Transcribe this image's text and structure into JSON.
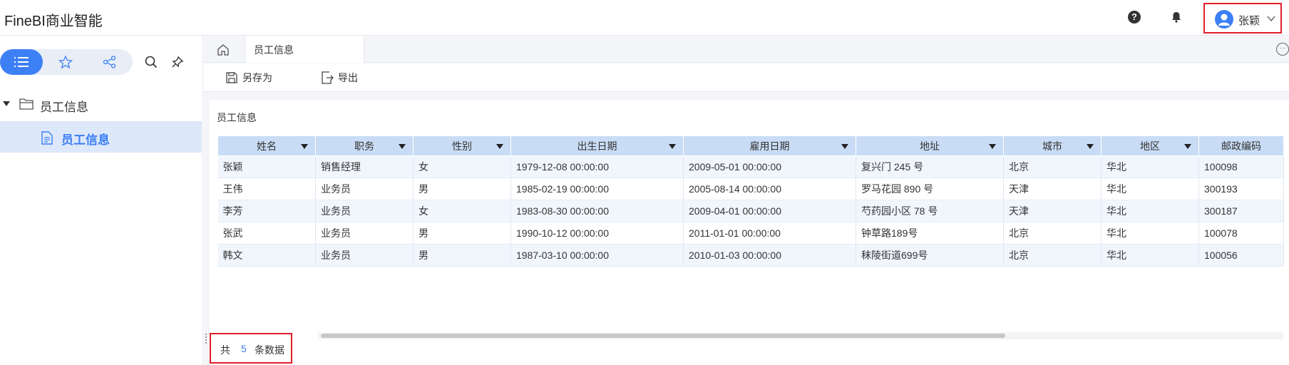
{
  "header": {
    "app_title": "FineBI商业智能",
    "help_glyph": "?",
    "user_name": "张颖"
  },
  "sidebar": {
    "tabs": [
      "list-icon",
      "star-icon",
      "share-icon"
    ],
    "tools": [
      "search-icon",
      "pin-icon"
    ],
    "folder_label": "员工信息",
    "file_label": "员工信息"
  },
  "tabs": {
    "active_tab_label": "员工信息",
    "more_glyph": "···"
  },
  "toolbar": {
    "save_as_label": "另存为",
    "export_label": "导出"
  },
  "content": {
    "title": "员工信息"
  },
  "table": {
    "columns": [
      "姓名",
      "职务",
      "性别",
      "出生日期",
      "雇用日期",
      "地址",
      "城市",
      "地区",
      "邮政编码"
    ],
    "rows": [
      [
        "张颖",
        "销售经理",
        "女",
        "1979-12-08 00:00:00",
        "2009-05-01 00:00:00",
        "复兴门 245 号",
        "北京",
        "华北",
        "100098"
      ],
      [
        "王伟",
        "业务员",
        "男",
        "1985-02-19 00:00:00",
        "2005-08-14 00:00:00",
        "罗马花园 890 号",
        "天津",
        "华北",
        "300193"
      ],
      [
        "李芳",
        "业务员",
        "女",
        "1983-08-30 00:00:00",
        "2009-04-01 00:00:00",
        "芍药园小区 78 号",
        "天津",
        "华北",
        "300187"
      ],
      [
        "张武",
        "业务员",
        "男",
        "1990-10-12 00:00:00",
        "2011-01-01 00:00:00",
        "钟草路189号",
        "北京",
        "华北",
        "100078"
      ],
      [
        "韩文",
        "业务员",
        "男",
        "1987-03-10 00:00:00",
        "2010-01-03 00:00:00",
        "秣陵街道699号",
        "北京",
        "华北",
        "100056"
      ]
    ]
  },
  "footer": {
    "prefix": "共",
    "count": "5",
    "suffix": "条数据"
  },
  "colors": {
    "accent": "#3d7ff5",
    "highlight_border": "#e0202a",
    "header_bg": "#c9dcf5"
  }
}
